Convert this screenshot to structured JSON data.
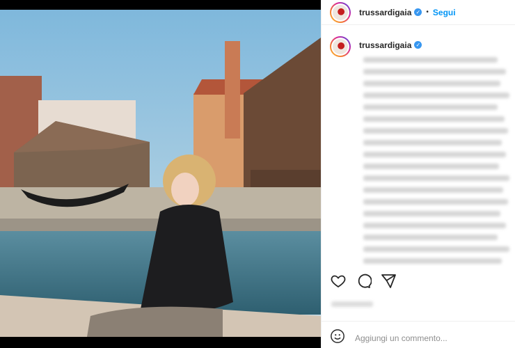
{
  "header": {
    "username": "trussardigaia",
    "separator": "•",
    "follow_label": "Segui"
  },
  "caption": {
    "username": "trussardigaia"
  },
  "actions": {
    "icons": [
      "heart-icon",
      "comment-icon",
      "share-icon"
    ]
  },
  "comment_box": {
    "placeholder": "Aggiungi un commento..."
  },
  "colors": {
    "accent": "#0095f6",
    "verified": "#3897f0"
  }
}
